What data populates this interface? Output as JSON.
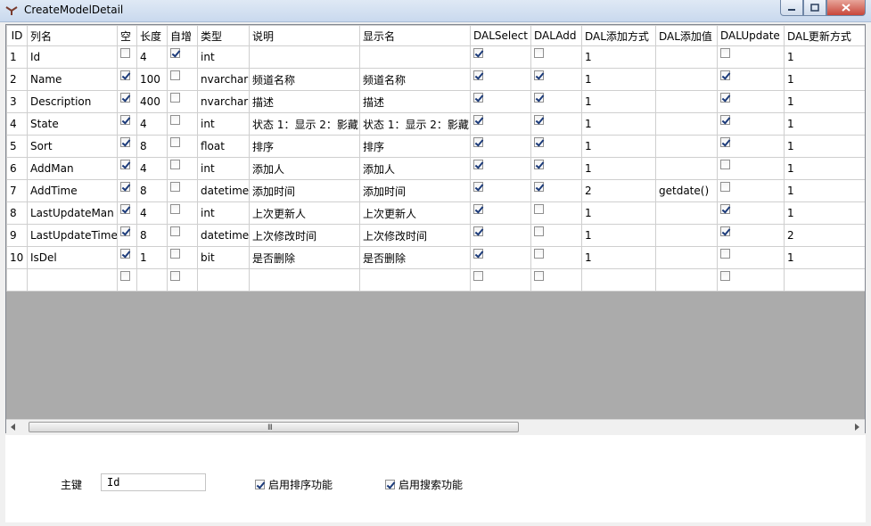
{
  "window": {
    "title": "CreateModelDetail"
  },
  "grid": {
    "columns": [
      "ID",
      "列名",
      "空",
      "长度",
      "自增",
      "类型",
      "说明",
      "显示名",
      "DALSelect",
      "DALAdd",
      "DAL添加方式",
      "DAL添加值",
      "DALUpdate",
      "DAL更新方式"
    ],
    "rows": [
      {
        "id": "1",
        "name": "Id",
        "nullable": false,
        "length": "4",
        "identity": true,
        "type": "int",
        "desc": "",
        "display": "",
        "dal_select": true,
        "dal_add": false,
        "add_mode": "1",
        "add_value": "",
        "dal_update": false,
        "update_mode": "1"
      },
      {
        "id": "2",
        "name": "Name",
        "nullable": true,
        "length": "100",
        "identity": false,
        "type": "nvarchar",
        "desc": "频道名称",
        "display": "频道名称",
        "dal_select": true,
        "dal_add": true,
        "add_mode": "1",
        "add_value": "",
        "dal_update": true,
        "update_mode": "1"
      },
      {
        "id": "3",
        "name": "Description",
        "nullable": true,
        "length": "400",
        "identity": false,
        "type": "nvarchar",
        "desc": "描述",
        "display": "描述",
        "dal_select": true,
        "dal_add": true,
        "add_mode": "1",
        "add_value": "",
        "dal_update": true,
        "update_mode": "1"
      },
      {
        "id": "4",
        "name": "State",
        "nullable": true,
        "length": "4",
        "identity": false,
        "type": "int",
        "desc": "状态 1：显示 2：影藏",
        "display": "状态 1：显示 2：影藏",
        "dal_select": true,
        "dal_add": true,
        "add_mode": "1",
        "add_value": "",
        "dal_update": true,
        "update_mode": "1"
      },
      {
        "id": "5",
        "name": "Sort",
        "nullable": true,
        "length": "8",
        "identity": false,
        "type": "float",
        "desc": "排序",
        "display": "排序",
        "dal_select": true,
        "dal_add": true,
        "add_mode": "1",
        "add_value": "",
        "dal_update": true,
        "update_mode": "1"
      },
      {
        "id": "6",
        "name": "AddMan",
        "nullable": true,
        "length": "4",
        "identity": false,
        "type": "int",
        "desc": "添加人",
        "display": "添加人",
        "dal_select": true,
        "dal_add": true,
        "add_mode": "1",
        "add_value": "",
        "dal_update": false,
        "update_mode": "1"
      },
      {
        "id": "7",
        "name": "AddTime",
        "nullable": true,
        "length": "8",
        "identity": false,
        "type": "datetime",
        "desc": "添加时间",
        "display": "添加时间",
        "dal_select": true,
        "dal_add": true,
        "add_mode": "2",
        "add_value": "getdate()",
        "dal_update": false,
        "update_mode": "1"
      },
      {
        "id": "8",
        "name": "LastUpdateMan",
        "nullable": true,
        "length": "4",
        "identity": false,
        "type": "int",
        "desc": "上次更新人",
        "display": "上次更新人",
        "dal_select": true,
        "dal_add": false,
        "add_mode": "1",
        "add_value": "",
        "dal_update": true,
        "update_mode": "1"
      },
      {
        "id": "9",
        "name": "LastUpdateTime",
        "nullable": true,
        "length": "8",
        "identity": false,
        "type": "datetime",
        "desc": "上次修改时间",
        "display": "上次修改时间",
        "dal_select": true,
        "dal_add": false,
        "add_mode": "1",
        "add_value": "",
        "dal_update": true,
        "update_mode": "2"
      },
      {
        "id": "10",
        "name": "IsDel",
        "nullable": true,
        "length": "1",
        "identity": false,
        "type": "bit",
        "desc": "是否删除",
        "display": "是否删除",
        "dal_select": true,
        "dal_add": false,
        "add_mode": "1",
        "add_value": "",
        "dal_update": false,
        "update_mode": "1"
      }
    ]
  },
  "hscroll": {
    "grip": "III"
  },
  "footer": {
    "primary_key_label": "主键",
    "primary_key_value": "Id",
    "enable_sort": {
      "label": "启用排序功能",
      "checked": true
    },
    "enable_search": {
      "label": "启用搜索功能",
      "checked": true
    }
  },
  "colors": {
    "titlebar": "#c9d9ee",
    "close_button": "#c7463a",
    "grid_background": "#ababab",
    "check_mark": "#1c3b7a"
  }
}
